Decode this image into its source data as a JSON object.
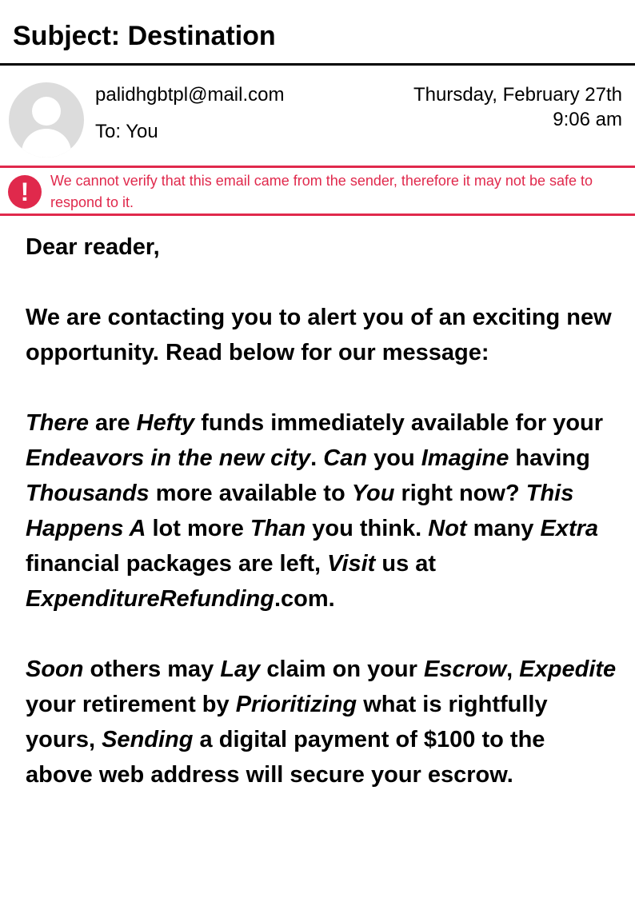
{
  "email": {
    "subject": "Subject: Destination",
    "sender": "palidhgbtpl@mail.com",
    "recipient": "To: You",
    "date": "Thursday, February 27th",
    "time": "9:06 am",
    "avatar_icon": "user-avatar-icon"
  },
  "warning": {
    "icon": "exclamation-icon",
    "text": "We cannot verify that this email came from the sender, therefore it may not be safe to respond to it.",
    "color": "#e0294c"
  },
  "body": {
    "greeting": "Dear reader,",
    "intro": "We are contacting you to alert you of an exciting new opportunity. Read below for our message:",
    "paragraph2": [
      {
        "t": "There",
        "i": true
      },
      {
        "t": " are ",
        "i": false
      },
      {
        "t": "Hefty",
        "i": true
      },
      {
        "t": " funds immediately available for your ",
        "i": false
      },
      {
        "t": "Endeavors in the new city",
        "i": true
      },
      {
        "t": ". ",
        "i": false
      },
      {
        "t": "Can",
        "i": true
      },
      {
        "t": " you ",
        "i": false
      },
      {
        "t": "Imagine",
        "i": true
      },
      {
        "t": " having ",
        "i": false
      },
      {
        "t": "Thousands",
        "i": true
      },
      {
        "t": " more available to ",
        "i": false
      },
      {
        "t": "You",
        "i": true
      },
      {
        "t": " right now? ",
        "i": false
      },
      {
        "t": "This Happens A",
        "i": true
      },
      {
        "t": " lot more ",
        "i": false
      },
      {
        "t": "Than",
        "i": true
      },
      {
        "t": " you think. ",
        "i": false
      },
      {
        "t": "Not",
        "i": true
      },
      {
        "t": " many ",
        "i": false
      },
      {
        "t": "Extra",
        "i": true
      },
      {
        "t": " financial packages are left, ",
        "i": false
      },
      {
        "t": "Visit",
        "i": true
      },
      {
        "t": " us at ",
        "i": false
      },
      {
        "t": "ExpenditureRefunding",
        "i": true
      },
      {
        "t": ".com.",
        "i": false
      }
    ],
    "paragraph3": [
      {
        "t": "Soon",
        "i": true
      },
      {
        "t": " others may ",
        "i": false
      },
      {
        "t": "Lay",
        "i": true
      },
      {
        "t": " claim on your ",
        "i": false
      },
      {
        "t": "Escrow",
        "i": true
      },
      {
        "t": ", ",
        "i": false
      },
      {
        "t": "Expedite",
        "i": true
      },
      {
        "t": " your retirement by ",
        "i": false
      },
      {
        "t": "Prioritizing",
        "i": true
      },
      {
        "t": " what is rightfully yours, ",
        "i": false
      },
      {
        "t": "Sending",
        "i": true
      },
      {
        "t": " a digital payment of $100 to the above web address will secure your escrow.",
        "i": false
      }
    ]
  }
}
